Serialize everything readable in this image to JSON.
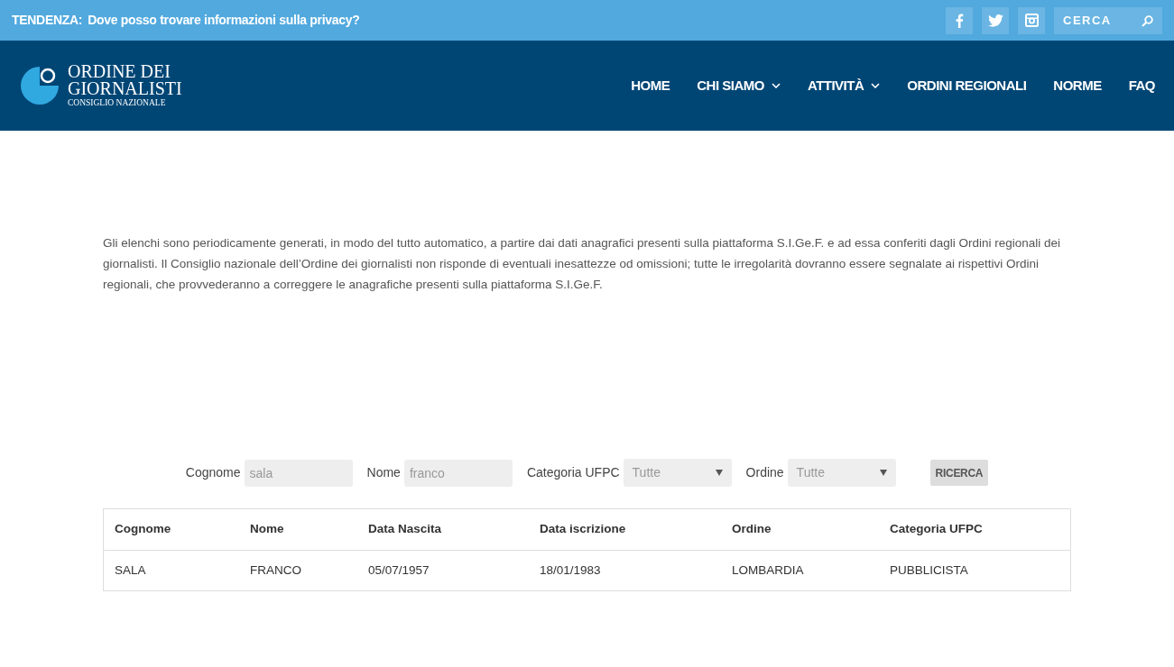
{
  "top_bar": {
    "trend_label": "TENDENZA:",
    "trend_link": "Dove posso trovare informazioni sulla privacy?",
    "social": [
      {
        "kind": "facebook"
      },
      {
        "kind": "twitter"
      },
      {
        "kind": "instagram"
      }
    ],
    "search": {
      "placeholder": "CERCA"
    }
  },
  "header": {
    "logo": {
      "line1": "ORDINE DEI",
      "line2": "GIORNALISTI",
      "line3": "CONSIGLIO NAZIONALE"
    },
    "nav": [
      {
        "label": "HOME",
        "has_submenu": false
      },
      {
        "label": "CHI SIAMO",
        "has_submenu": true
      },
      {
        "label": "ATTIVITÀ",
        "has_submenu": true
      },
      {
        "label": "ORDINI REGIONALI",
        "has_submenu": false
      },
      {
        "label": "NORME",
        "has_submenu": false
      },
      {
        "label": "FAQ",
        "has_submenu": false
      }
    ]
  },
  "notice": "Gli elenchi sono periodicamente generati, in modo del tutto automatico, a partire dai dati anagrafici presenti sulla piattaforma S.I.Ge.F. e ad essa conferiti dagli Ordini regionali dei giornalisti. Il Consiglio nazionale dell’Ordine dei giornalisti non risponde di eventuali inesattezze od omissioni; tutte le irregolarità dovranno essere segnalate ai rispettivi Ordini regionali, che provvederanno a correggere le anagrafiche presenti sulla piattaforma S.I.Ge.F.",
  "search_form": {
    "fields": [
      {
        "kind": "text",
        "label": "Cognome",
        "value": "sala"
      },
      {
        "kind": "text",
        "label": "Nome",
        "value": "franco"
      },
      {
        "kind": "select",
        "label": "Categoria UFPC",
        "value": "Tutte"
      },
      {
        "kind": "select",
        "label": "Ordine",
        "value": "Tutte"
      }
    ],
    "button": "RICERCA"
  },
  "table": {
    "columns": [
      "Cognome",
      "Nome",
      "Data Nascita",
      "Data iscrizione",
      "Ordine",
      "Categoria UFPC"
    ],
    "rows": [
      [
        "SALA",
        "FRANCO",
        "05/07/1957",
        "18/01/1983",
        "LOMBARDIA",
        "PUBBLICISTA"
      ]
    ]
  }
}
